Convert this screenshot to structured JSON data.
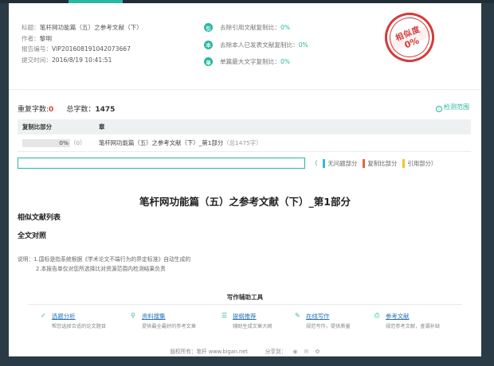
{
  "report": {
    "title_label": "标题：",
    "title_value": "笔杆网功能篇（五）之参考文献（下）",
    "author_label": "作者：",
    "author_value": "黎明",
    "report_no_label": "报告编号：",
    "report_no_value": "VIP201608191042073667",
    "submit_time_label": "提交时间：",
    "submit_time_value": "2016/8/19 10:41:51"
  },
  "stats": [
    {
      "icon": "引",
      "label": "去除引用文献复制比：",
      "value": "0%"
    },
    {
      "icon": "本",
      "label": "去除本人已发表文献复制比：",
      "value": "0%"
    },
    {
      "icon": "单",
      "label": "单篇最大文字复制比：",
      "value": "0%"
    }
  ],
  "stamp": {
    "label": "相似度",
    "value": "0%"
  },
  "summary": {
    "repeat_label": "重复字数:",
    "repeat_value": "0",
    "total_label": "总字数：",
    "total_value": "1475",
    "detect_label": "检测范围"
  },
  "table": {
    "headers": [
      "复制比部分",
      "章"
    ],
    "rows": [
      {
        "ratio": "0%",
        "count": "（0）",
        "chapter": "笔杆网功能篇（五）之参考文献（下）_第1部分",
        "chapter_total": "（总1475字）"
      }
    ]
  },
  "progress": {
    "fraction": 0.0
  },
  "legend": [
    {
      "label": "无问题部分",
      "color": "#36b8d8"
    },
    {
      "label": "复制比部分",
      "color": "#e0663e"
    },
    {
      "label": "引用部分",
      "color": "#f2c32b"
    }
  ],
  "legend_open": "（",
  "legend_close": "）",
  "section": {
    "title": "笔杆网功能篇（五）之参考文献（下）_第1部分",
    "similar_list": "相似文献列表",
    "full_compare": "全文对照"
  },
  "notes": {
    "line1": "说明：1.国标是指系统根据《学术论文不端行为的界定标准》自动生成的",
    "line2": "2.本报告单仅对您所选择比对资源范围内检测结果负责"
  },
  "tools": {
    "heading": "写作辅助工具",
    "items": [
      {
        "icon": "✓",
        "name": "选题分析",
        "desc": "帮您选择合适的论文题目"
      },
      {
        "icon": "⚲",
        "name": "资料搜集",
        "desc": "提供最全最好的参考文章"
      },
      {
        "icon": "☰",
        "name": "提纲推荐",
        "desc": "辅助生成文章大纲"
      },
      {
        "icon": "✎",
        "name": "在线写作",
        "desc": "规范写作，提供质量"
      },
      {
        "icon": "⎙",
        "name": "参考文献",
        "desc": "规范参考文献，查漏补缺"
      }
    ]
  },
  "footer": {
    "copyright": "版权所有：笔杆 www.bigan.net",
    "share_label": "分享到："
  },
  "colors": {
    "accent": "#27b89f",
    "red": "#d33b3b",
    "link": "#2673b8"
  }
}
